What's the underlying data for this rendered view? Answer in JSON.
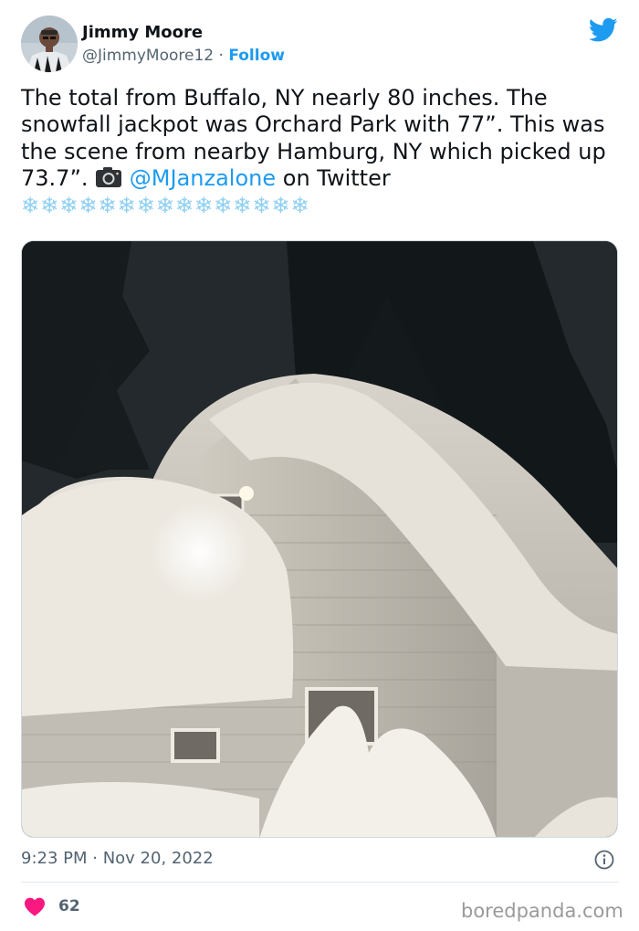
{
  "author": {
    "name": "Jimmy Moore",
    "handle": "@JimmyMoore12",
    "separator": "·",
    "follow_label": "Follow"
  },
  "tweet": {
    "text_part1": "The total from Buffalo, NY nearly 80 inches. The snowfall jackpot was Orchard Park with 77”. This was the scene from nearby Hamburg, NY which picked up 73.7”. ",
    "mention": "@MJanzalone",
    "text_part2": " on Twitter ",
    "flakes": "❄❄❄❄❄❄❄❄❄❄❄❄❄❄❄"
  },
  "timestamp": "9:23 PM · Nov 20, 2022",
  "likes": {
    "count": "62"
  },
  "watermark": "boredpanda.com",
  "colors": {
    "accent": "#1d9bf0",
    "heart": "#f91880",
    "snowflake": "#8fd0f2"
  },
  "icons": [
    "avatar",
    "twitter-bird-icon",
    "camera-icon",
    "snowflake-icon",
    "info-icon",
    "heart-icon"
  ]
}
